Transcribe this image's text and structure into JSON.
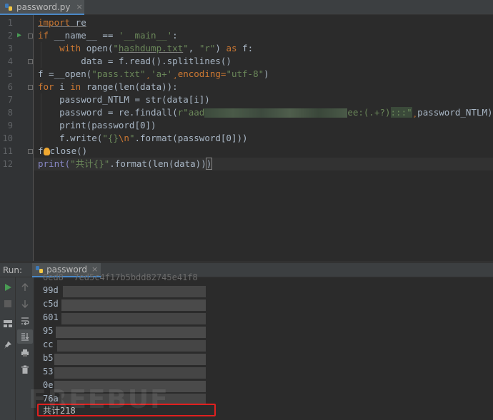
{
  "editor": {
    "tab_name": "password.py",
    "tab_close": "×",
    "line_numbers": [
      "1",
      "2",
      "3",
      "4",
      "5",
      "6",
      "7",
      "8",
      "9",
      "10",
      "11",
      "12"
    ]
  },
  "code": {
    "l1_import": "import",
    "l1_re": " re",
    "l2_if": "if",
    "l2_name": " __name__ == ",
    "l2_str": "'__main__'",
    "l2_colon": ":",
    "l3_with": "    with",
    "l3_open": " open(",
    "l3_q1": "\"",
    "l3_file": "hashdump.txt",
    "l3_q2": "\"",
    "l3_comma": ", ",
    "l3_r": "\"r\"",
    "l3_paren": ") ",
    "l3_as": "as",
    "l3_f": " f:",
    "l4_text": "        data = f.read().splitlines()",
    "l5_f": "f =",
    "l5_open": "__open(",
    "l5_pass": "\"pass.txt\"",
    "l5_c1": "¸",
    "l5_a": "'a+'",
    "l5_c2": "¸",
    "l5_enc": "encoding=",
    "l5_utf": "\"utf-8\"",
    "l5_end": ")",
    "l6_for": "for",
    "l6_i": " i ",
    "l6_in": "in",
    "l6_range": " range(len(data)):",
    "l7_text": "    password_NTLM = str(data[i])",
    "l8_pre": "    password = re.findall(",
    "l8_r": "r\"aad",
    "l8_post": "ee:(.+?)",
    "l8_colons": ":::\"",
    "l8_c": "¸",
    "l8_end": "password_NTLM)",
    "l9_text": "    print(password[0])",
    "l10_pre": "    f.write(",
    "l10_s1": "\"{}",
    "l10_esc": "\\n",
    "l10_s2": "\"",
    "l10_post": ".format(password[0]))",
    "l11_f": "f",
    "l11_close": "close()",
    "l12_print": "print(",
    "l12_str": "\"共计{}\"",
    "l12_fmt": ".format(len(data))",
    "l12_last": ")"
  },
  "run": {
    "title": "Run:",
    "tab_name": "password",
    "tab_close": "×"
  },
  "output": {
    "partial_top": "6ed8  7ed5c4f17b5bdd82745e41f8",
    "lines": [
      "99d",
      "c5d",
      "601",
      "95",
      "cc",
      "b5",
      "53",
      "0e",
      "76a"
    ],
    "total": "共计218"
  },
  "watermark": "FREEBUF",
  "colors": {
    "keyword": "#cc7832",
    "string": "#6a8759",
    "builtin": "#8888c6",
    "highlight_box": "#e0201f",
    "run_green": "#499c54"
  }
}
